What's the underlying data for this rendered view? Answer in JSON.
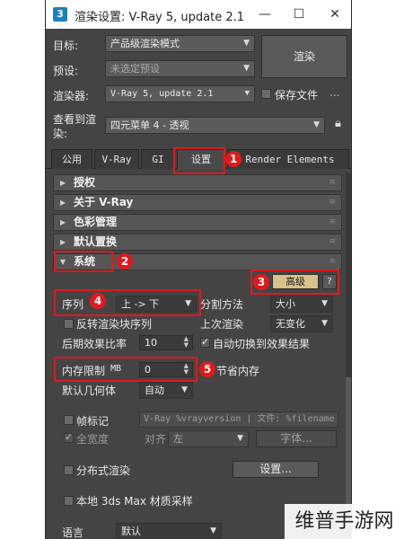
{
  "window": {
    "title": "渲染设置: V-Ray 5, update 2.1",
    "app_icon": "3",
    "min": "—",
    "max": "☐",
    "close": "✕"
  },
  "top": {
    "target_label": "目标:",
    "target_value": "产品级渲染模式",
    "preset_label": "预设:",
    "preset_value": "未选定预设",
    "renderer_label": "渲染器:",
    "renderer_value": "V-Ray 5, update 2.1",
    "save_file_label": "保存文件",
    "more": "...",
    "view_label_1": "查看到渲",
    "view_label_2": "染:",
    "view_value": "四元菜单 4 - 透视",
    "render_button": "渲染"
  },
  "tabs": [
    {
      "label": "公用"
    },
    {
      "label": "V-Ray"
    },
    {
      "label": "GI"
    },
    {
      "label": "设置"
    },
    {
      "label": "Render Elements"
    }
  ],
  "sections": {
    "license": "授权",
    "about": "关于 V-Ray",
    "color_mgmt": "色彩管理",
    "default_displace": "默认置换",
    "system": "系统"
  },
  "system": {
    "advanced_button": "高级",
    "help_button": "?",
    "sequence_label": "序列",
    "sequence_value": "上 -> 下",
    "split_method_label": "分割方法",
    "split_method_value": "大小",
    "reverse_label": "反转渲染块序列",
    "last_render_label": "上次渲染",
    "last_render_value": "无变化",
    "post_effects_label": "后期效果比率",
    "post_effects_value": "10",
    "auto_switch_label": "自动切换到效果结果",
    "mem_limit_label": "内存限制",
    "mem_limit_unit": "MB",
    "mem_limit_value": "0",
    "save_memory_label": "节省内存",
    "default_geo_label": "默认几何体",
    "default_geo_value": "自动",
    "frame_stamp_label": "帧标记",
    "frame_stamp_text": "V-Ray %vrayversion | 文件: %filename",
    "full_width_label": "全宽度",
    "align_label": "对齐",
    "align_value": "左",
    "font_button": "字体...",
    "distributed_label": "分布式渲染",
    "dr_settings_button": "设置...",
    "local_3ds_label": "本地 3ds Max 材质采样",
    "language_label": "语言",
    "language_value": "默认"
  },
  "annotations": [
    "1",
    "2",
    "3",
    "4",
    "5"
  ],
  "watermark": "维普手游网"
}
